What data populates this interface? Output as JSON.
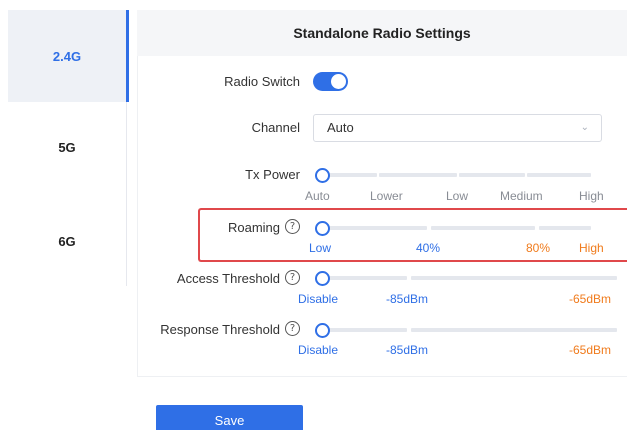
{
  "bands": [
    {
      "label": "2.4G",
      "active": true
    },
    {
      "label": "5G",
      "active": false
    },
    {
      "label": "6G",
      "active": false
    }
  ],
  "card": {
    "title": "Standalone Radio Settings"
  },
  "radio_switch": {
    "label": "Radio Switch",
    "on": true
  },
  "channel": {
    "label": "Channel",
    "value": "Auto"
  },
  "tx_power": {
    "label": "Tx Power",
    "ticks": [
      "Auto",
      "Lower",
      "Low",
      "Medium",
      "High"
    ],
    "value": "Auto"
  },
  "roaming": {
    "label": "Roaming",
    "ticks": [
      "Low",
      "40%",
      "80%",
      "High"
    ],
    "value": "Low"
  },
  "access_threshold": {
    "label": "Access Threshold",
    "ticks": [
      "Disable",
      "-85dBm",
      "-65dBm"
    ],
    "value": "Disable"
  },
  "response_threshold": {
    "label": "Response Threshold",
    "ticks": [
      "Disable",
      "-85dBm",
      "-65dBm"
    ],
    "value": "Disable"
  },
  "help_glyph": "?",
  "save_label": "Save",
  "colors": {
    "accent": "#2f6fe6",
    "orange": "#f07b1c",
    "highlight_box": "#e0484b"
  }
}
